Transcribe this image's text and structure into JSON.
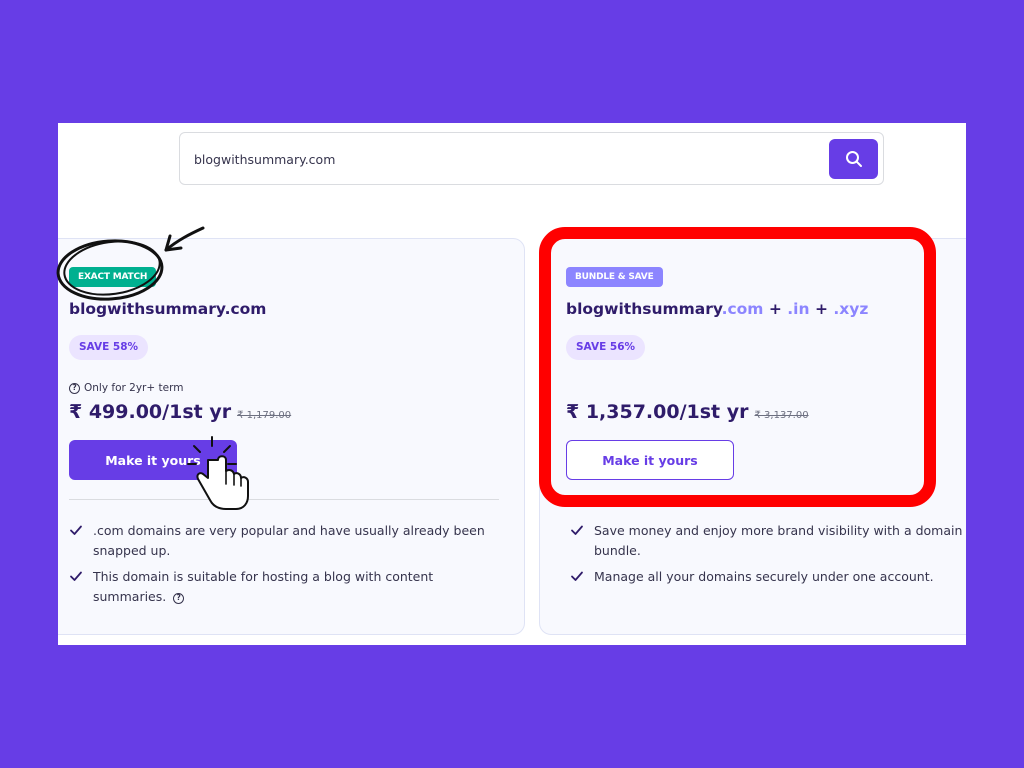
{
  "search": {
    "value": "blogwithsummary.com"
  },
  "exact_card": {
    "badge": "EXACT MATCH",
    "domain": "blogwithsummary.com",
    "save": "SAVE 58%",
    "term_note": "Only for 2yr+ term",
    "price": "₹ 499.00/1st yr",
    "old_price": "₹ 1,179.00",
    "cta": "Make it yours",
    "features": [
      ".com domains are very popular and have usually already been snapped up.",
      "This domain is suitable for hosting a blog with content summaries."
    ]
  },
  "bundle_card": {
    "badge": "BUNDLE & SAVE",
    "domain_name": "blogwithsummary",
    "tlds": [
      ".com",
      ".in",
      ".xyz"
    ],
    "plus": "+",
    "save": "SAVE 56%",
    "price": "₹ 1,357.00/1st yr",
    "old_price": "₹ 3,137.00",
    "cta": "Make it yours",
    "features": [
      "Save money and enjoy more brand visibility with a domain bundle.",
      "Manage all your domains securely under one account."
    ]
  },
  "icons": {
    "search": "search-icon",
    "help": "question-circle-icon",
    "check": "check-icon",
    "pointer": "hand-pointer-icon",
    "arrow": "hand-drawn-arrow-icon"
  },
  "colors": {
    "background": "#673de6",
    "accent": "#673de6",
    "badge_green": "#00b090",
    "badge_purple": "#8c85ff",
    "highlight_red": "#ff0000"
  }
}
